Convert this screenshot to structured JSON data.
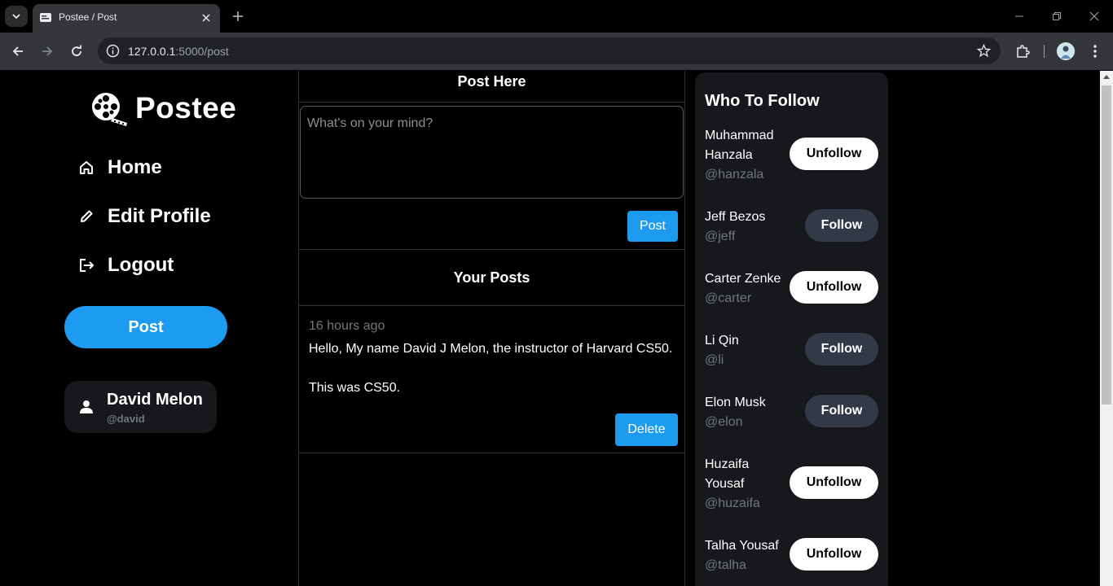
{
  "browser": {
    "tab_title": "Postee / Post",
    "url_host": "127.0.0.1",
    "url_rest": ":5000/post"
  },
  "sidebar": {
    "logo_text": "Postee",
    "nav": [
      {
        "label": "Home",
        "icon": "home-icon"
      },
      {
        "label": "Edit Profile",
        "icon": "pencil-icon"
      },
      {
        "label": "Logout",
        "icon": "logout-icon"
      }
    ],
    "post_button": "Post",
    "user": {
      "name": "David Melon",
      "handle": "@david"
    }
  },
  "compose": {
    "heading": "Post Here",
    "placeholder": "What's on your mind?",
    "submit_label": "Post"
  },
  "your_posts": {
    "heading": "Your Posts",
    "posts": [
      {
        "time": "16 hours ago",
        "line1": "Hello, My name David J Melon, the instructor of Harvard CS50.",
        "line2": "This was CS50.",
        "delete_label": "Delete"
      }
    ]
  },
  "who_to_follow": {
    "title": "Who To Follow",
    "users": [
      {
        "name_line1": "Muhammad",
        "name_line2": "Hanzala",
        "handle": "@hanzala",
        "action": "Unfollow"
      },
      {
        "name_line1": "Jeff Bezos",
        "name_line2": "",
        "handle": "@jeff",
        "action": "Follow"
      },
      {
        "name_line1": "Carter Zenke",
        "name_line2": "",
        "handle": "@carter",
        "action": "Unfollow"
      },
      {
        "name_line1": "Li Qin",
        "name_line2": "",
        "handle": "@li",
        "action": "Follow"
      },
      {
        "name_line1": "Elon Musk",
        "name_line2": "",
        "handle": "@elon",
        "action": "Follow"
      },
      {
        "name_line1": "Huzaifa",
        "name_line2": "Yousaf",
        "handle": "@huzaifa",
        "action": "Unfollow"
      },
      {
        "name_line1": "Talha Yousaf",
        "name_line2": "",
        "handle": "@talha",
        "action": "Unfollow"
      }
    ]
  }
}
